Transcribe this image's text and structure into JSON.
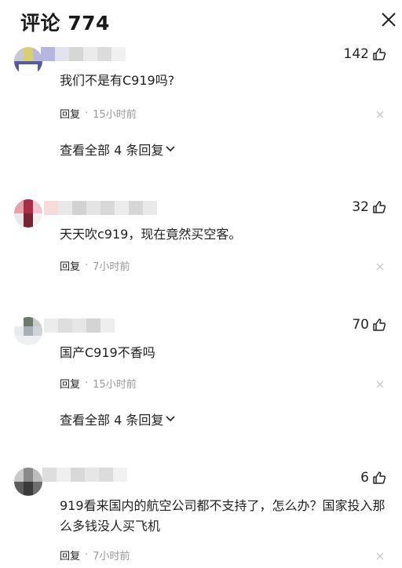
{
  "header": {
    "title": "评论 774"
  },
  "comments": [
    {
      "likes": "142",
      "text": "我们不是有C919吗?",
      "reply_label": "回复",
      "separator": "·",
      "time": "15小时前",
      "view_replies": "查看全部 4 条回复"
    },
    {
      "likes": "32",
      "text": "天天吹c919，现在竟然买空客。",
      "reply_label": "回复",
      "separator": "·",
      "time": "7小时前"
    },
    {
      "likes": "70",
      "text": "国产C919不香吗",
      "reply_label": "回复",
      "separator": "·",
      "time": "15小时前",
      "view_replies": "查看全部 4 条回复"
    },
    {
      "likes": "6",
      "text": "919看来国内的航空公司都不支持了，怎么办？国家投入那么多钱没人买飞机",
      "reply_label": "回复",
      "separator": "·",
      "time": "7小时前"
    }
  ],
  "icons": {
    "close": "close-icon",
    "like": "thumbs-up-icon",
    "more": "dismiss-x-icon",
    "chevron": "chevron-down-icon"
  },
  "colors": {
    "text": "#222222",
    "meta": "#999999",
    "background": "#ffffff"
  }
}
